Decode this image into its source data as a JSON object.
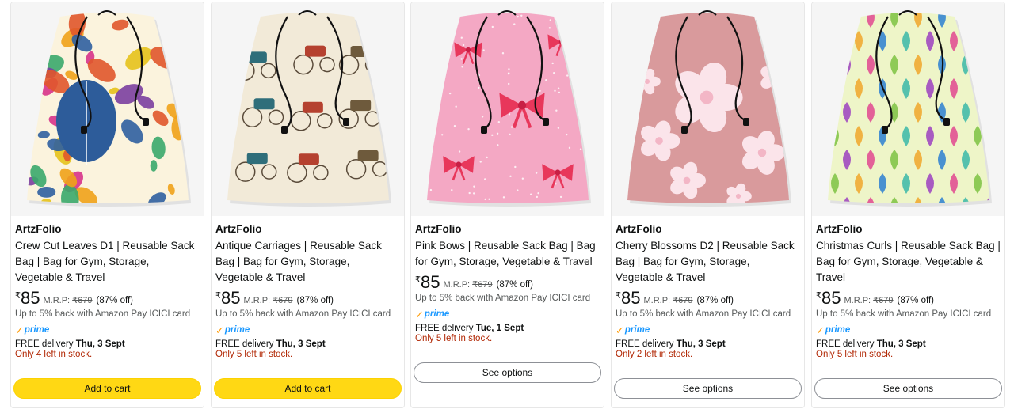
{
  "products": [
    {
      "brand": "ArtzFolio",
      "title": "Crew Cut Leaves D1 | Reusable Sack Bag | Bag for Gym, Storage, Vegetable & Travel",
      "rupee": "₹",
      "price": "85",
      "mrp_label": "M.R.P:",
      "mrp": "₹679",
      "discount": "(87% off)",
      "cashback": "Up to 5% back with Amazon Pay ICICI card",
      "prime": "prime",
      "delivery_prefix": "FREE delivery ",
      "delivery_date": "Thu, 3 Sept",
      "stock": "Only 4 left in stock.",
      "button": "Add to cart",
      "button_type": "cart",
      "pattern": "leaves",
      "bg_color": "#fbf3dd"
    },
    {
      "brand": "ArtzFolio",
      "title": "Antique Carriages | Reusable Sack Bag | Bag for Gym, Storage, Vegetable & Travel",
      "rupee": "₹",
      "price": "85",
      "mrp_label": "M.R.P:",
      "mrp": "₹679",
      "discount": "(87% off)",
      "cashback": "Up to 5% back with Amazon Pay ICICI card",
      "prime": "prime",
      "delivery_prefix": "FREE delivery ",
      "delivery_date": "Thu, 3 Sept",
      "stock": "Only 5 left in stock.",
      "button": "Add to cart",
      "button_type": "cart",
      "pattern": "carriages",
      "bg_color": "#f2ead8"
    },
    {
      "brand": "ArtzFolio",
      "title": "Pink Bows | Reusable Sack Bag | Bag for Gym, Storage, Vegetable & Travel",
      "rupee": "₹",
      "price": "85",
      "mrp_label": "M.R.P:",
      "mrp": "₹679",
      "discount": "(87% off)",
      "cashback": "Up to 5% back with Amazon Pay ICICI card",
      "prime": "prime",
      "delivery_prefix": "FREE delivery ",
      "delivery_date": "Tue, 1 Sept",
      "stock": "Only 5 left in stock.",
      "button": "See options",
      "button_type": "options",
      "pattern": "bows",
      "bg_color": "#f4a8c4"
    },
    {
      "brand": "ArtzFolio",
      "title": "Cherry Blossoms D2 | Reusable Sack Bag | Bag for Gym, Storage, Vegetable & Travel",
      "rupee": "₹",
      "price": "85",
      "mrp_label": "M.R.P:",
      "mrp": "₹679",
      "discount": "(87% off)",
      "cashback": "Up to 5% back with Amazon Pay ICICI card",
      "prime": "prime",
      "delivery_prefix": "FREE delivery ",
      "delivery_date": "Thu, 3 Sept",
      "stock": "Only 2 left in stock.",
      "button": "See options",
      "button_type": "options",
      "pattern": "blossoms",
      "bg_color": "#d99a9c"
    },
    {
      "brand": "ArtzFolio",
      "title": "Christmas Curls | Reusable Sack Bag | Bag for Gym, Storage, Vegetable & Travel",
      "rupee": "₹",
      "price": "85",
      "mrp_label": "M.R.P:",
      "mrp": "₹679",
      "discount": "(87% off)",
      "cashback": "Up to 5% back with Amazon Pay ICICI card",
      "prime": "prime",
      "delivery_prefix": "FREE delivery ",
      "delivery_date": "Thu, 3 Sept",
      "stock": "Only 5 left in stock.",
      "button": "See options",
      "button_type": "options",
      "pattern": "curls",
      "bg_color": "#eef5c8"
    }
  ]
}
